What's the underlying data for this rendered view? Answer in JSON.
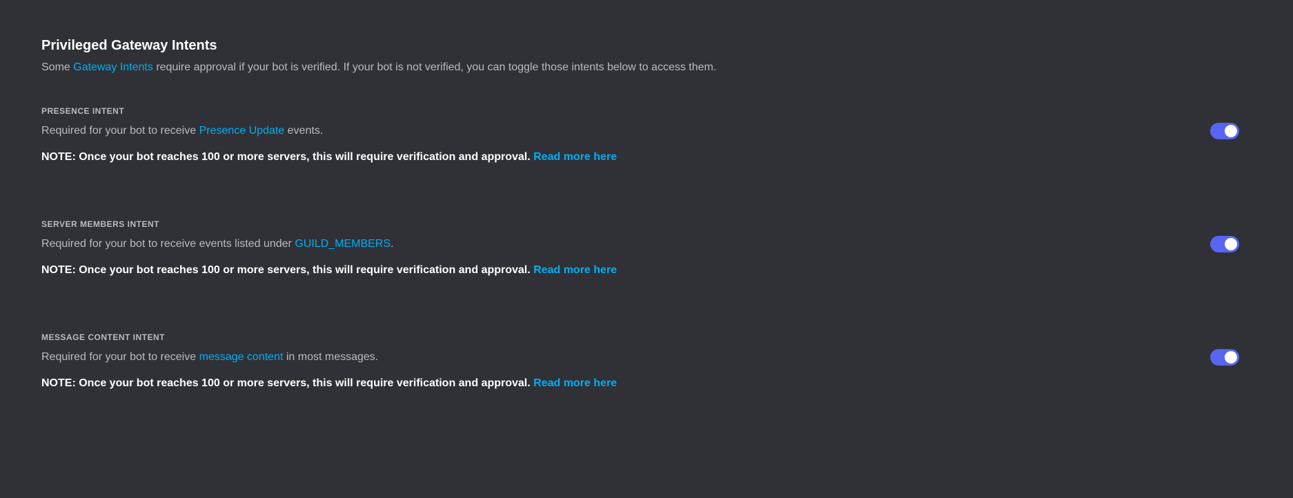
{
  "header": {
    "title": "Privileged Gateway Intents",
    "desc_prefix": "Some ",
    "desc_link": "Gateway Intents",
    "desc_suffix": " require approval if your bot is verified. If your bot is not verified, you can toggle those intents below to access them."
  },
  "intents": {
    "presence": {
      "label": "PRESENCE INTENT",
      "desc_prefix": "Required for your bot to receive ",
      "desc_link": "Presence Update",
      "desc_suffix": " events.",
      "note_prefix": "NOTE: Once your bot reaches 100 or more servers, this will require verification and approval. ",
      "note_link": "Read more here"
    },
    "members": {
      "label": "SERVER MEMBERS INTENT",
      "desc_prefix": "Required for your bot to receive events listed under ",
      "desc_link": "GUILD_MEMBERS",
      "desc_suffix": ".",
      "note_prefix": "NOTE: Once your bot reaches 100 or more servers, this will require verification and approval. ",
      "note_link": "Read more here"
    },
    "message": {
      "label": "MESSAGE CONTENT INTENT",
      "desc_prefix": "Required for your bot to receive ",
      "desc_link": "message content",
      "desc_suffix": " in most messages.",
      "note_prefix": "NOTE: Once your bot reaches 100 or more servers, this will require verification and approval. ",
      "note_link": "Read more here"
    }
  }
}
